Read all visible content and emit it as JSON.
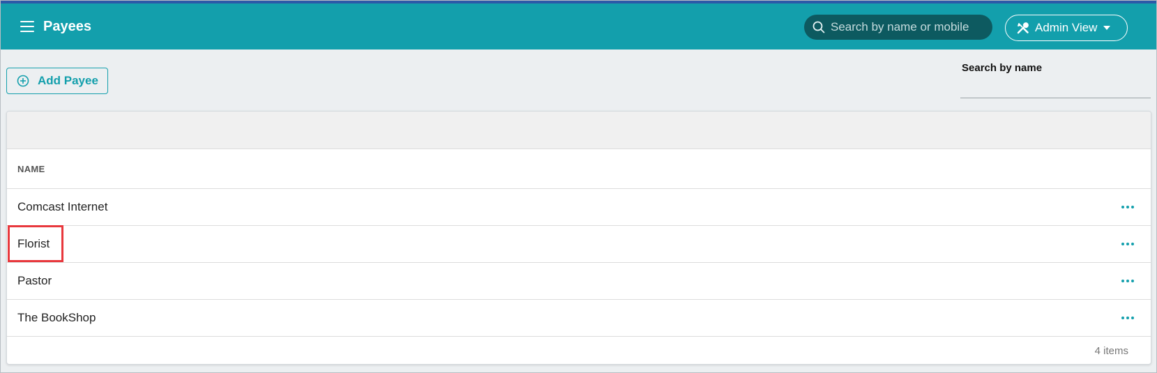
{
  "header": {
    "title": "Payees",
    "search_placeholder": "Search by name or mobile",
    "admin_label": "Admin View"
  },
  "toolbar": {
    "add_payee_label": "Add Payee"
  },
  "filter": {
    "search_label": "Search by name"
  },
  "table": {
    "column_name": "NAME",
    "rows": [
      {
        "name": "Comcast Internet"
      },
      {
        "name": "Florist"
      },
      {
        "name": "Pastor"
      },
      {
        "name": "The BookShop"
      }
    ],
    "footer": "4 items"
  },
  "colors": {
    "brand": "#139fac",
    "header_top_border": "#2b59a8",
    "highlight": "#e8383d"
  },
  "icons": {
    "menu": "hamburger-icon",
    "search": "search-icon",
    "admin": "tools-icon",
    "add": "plus-circle-icon",
    "row_action": "more-horizontal-icon"
  }
}
